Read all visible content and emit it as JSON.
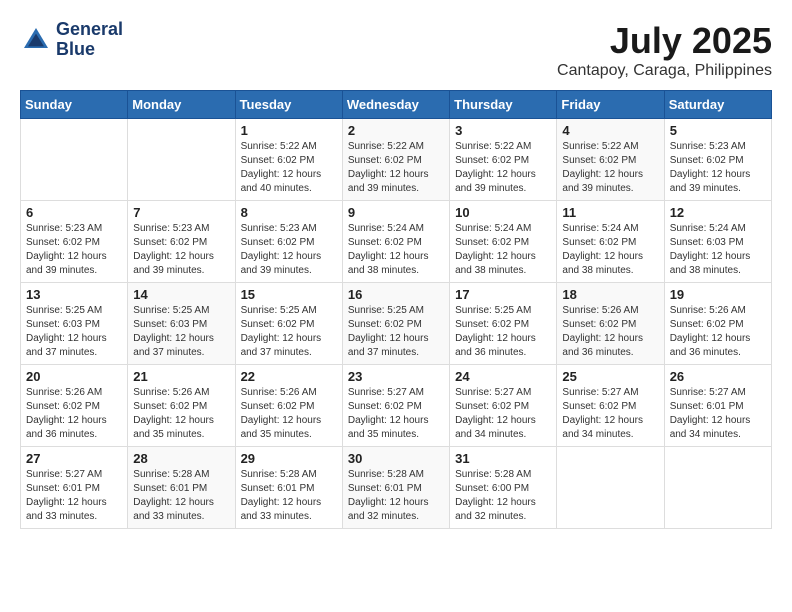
{
  "app": {
    "name_line1": "General",
    "name_line2": "Blue"
  },
  "calendar": {
    "title": "July 2025",
    "subtitle": "Cantapoy, Caraga, Philippines"
  },
  "headers": [
    "Sunday",
    "Monday",
    "Tuesday",
    "Wednesday",
    "Thursday",
    "Friday",
    "Saturday"
  ],
  "weeks": [
    [
      {
        "day": "",
        "sunrise": "",
        "sunset": "",
        "daylight": ""
      },
      {
        "day": "",
        "sunrise": "",
        "sunset": "",
        "daylight": ""
      },
      {
        "day": "1",
        "sunrise": "Sunrise: 5:22 AM",
        "sunset": "Sunset: 6:02 PM",
        "daylight": "Daylight: 12 hours and 40 minutes."
      },
      {
        "day": "2",
        "sunrise": "Sunrise: 5:22 AM",
        "sunset": "Sunset: 6:02 PM",
        "daylight": "Daylight: 12 hours and 39 minutes."
      },
      {
        "day": "3",
        "sunrise": "Sunrise: 5:22 AM",
        "sunset": "Sunset: 6:02 PM",
        "daylight": "Daylight: 12 hours and 39 minutes."
      },
      {
        "day": "4",
        "sunrise": "Sunrise: 5:22 AM",
        "sunset": "Sunset: 6:02 PM",
        "daylight": "Daylight: 12 hours and 39 minutes."
      },
      {
        "day": "5",
        "sunrise": "Sunrise: 5:23 AM",
        "sunset": "Sunset: 6:02 PM",
        "daylight": "Daylight: 12 hours and 39 minutes."
      }
    ],
    [
      {
        "day": "6",
        "sunrise": "Sunrise: 5:23 AM",
        "sunset": "Sunset: 6:02 PM",
        "daylight": "Daylight: 12 hours and 39 minutes."
      },
      {
        "day": "7",
        "sunrise": "Sunrise: 5:23 AM",
        "sunset": "Sunset: 6:02 PM",
        "daylight": "Daylight: 12 hours and 39 minutes."
      },
      {
        "day": "8",
        "sunrise": "Sunrise: 5:23 AM",
        "sunset": "Sunset: 6:02 PM",
        "daylight": "Daylight: 12 hours and 39 minutes."
      },
      {
        "day": "9",
        "sunrise": "Sunrise: 5:24 AM",
        "sunset": "Sunset: 6:02 PM",
        "daylight": "Daylight: 12 hours and 38 minutes."
      },
      {
        "day": "10",
        "sunrise": "Sunrise: 5:24 AM",
        "sunset": "Sunset: 6:02 PM",
        "daylight": "Daylight: 12 hours and 38 minutes."
      },
      {
        "day": "11",
        "sunrise": "Sunrise: 5:24 AM",
        "sunset": "Sunset: 6:02 PM",
        "daylight": "Daylight: 12 hours and 38 minutes."
      },
      {
        "day": "12",
        "sunrise": "Sunrise: 5:24 AM",
        "sunset": "Sunset: 6:03 PM",
        "daylight": "Daylight: 12 hours and 38 minutes."
      }
    ],
    [
      {
        "day": "13",
        "sunrise": "Sunrise: 5:25 AM",
        "sunset": "Sunset: 6:03 PM",
        "daylight": "Daylight: 12 hours and 37 minutes."
      },
      {
        "day": "14",
        "sunrise": "Sunrise: 5:25 AM",
        "sunset": "Sunset: 6:03 PM",
        "daylight": "Daylight: 12 hours and 37 minutes."
      },
      {
        "day": "15",
        "sunrise": "Sunrise: 5:25 AM",
        "sunset": "Sunset: 6:02 PM",
        "daylight": "Daylight: 12 hours and 37 minutes."
      },
      {
        "day": "16",
        "sunrise": "Sunrise: 5:25 AM",
        "sunset": "Sunset: 6:02 PM",
        "daylight": "Daylight: 12 hours and 37 minutes."
      },
      {
        "day": "17",
        "sunrise": "Sunrise: 5:25 AM",
        "sunset": "Sunset: 6:02 PM",
        "daylight": "Daylight: 12 hours and 36 minutes."
      },
      {
        "day": "18",
        "sunrise": "Sunrise: 5:26 AM",
        "sunset": "Sunset: 6:02 PM",
        "daylight": "Daylight: 12 hours and 36 minutes."
      },
      {
        "day": "19",
        "sunrise": "Sunrise: 5:26 AM",
        "sunset": "Sunset: 6:02 PM",
        "daylight": "Daylight: 12 hours and 36 minutes."
      }
    ],
    [
      {
        "day": "20",
        "sunrise": "Sunrise: 5:26 AM",
        "sunset": "Sunset: 6:02 PM",
        "daylight": "Daylight: 12 hours and 36 minutes."
      },
      {
        "day": "21",
        "sunrise": "Sunrise: 5:26 AM",
        "sunset": "Sunset: 6:02 PM",
        "daylight": "Daylight: 12 hours and 35 minutes."
      },
      {
        "day": "22",
        "sunrise": "Sunrise: 5:26 AM",
        "sunset": "Sunset: 6:02 PM",
        "daylight": "Daylight: 12 hours and 35 minutes."
      },
      {
        "day": "23",
        "sunrise": "Sunrise: 5:27 AM",
        "sunset": "Sunset: 6:02 PM",
        "daylight": "Daylight: 12 hours and 35 minutes."
      },
      {
        "day": "24",
        "sunrise": "Sunrise: 5:27 AM",
        "sunset": "Sunset: 6:02 PM",
        "daylight": "Daylight: 12 hours and 34 minutes."
      },
      {
        "day": "25",
        "sunrise": "Sunrise: 5:27 AM",
        "sunset": "Sunset: 6:02 PM",
        "daylight": "Daylight: 12 hours and 34 minutes."
      },
      {
        "day": "26",
        "sunrise": "Sunrise: 5:27 AM",
        "sunset": "Sunset: 6:01 PM",
        "daylight": "Daylight: 12 hours and 34 minutes."
      }
    ],
    [
      {
        "day": "27",
        "sunrise": "Sunrise: 5:27 AM",
        "sunset": "Sunset: 6:01 PM",
        "daylight": "Daylight: 12 hours and 33 minutes."
      },
      {
        "day": "28",
        "sunrise": "Sunrise: 5:28 AM",
        "sunset": "Sunset: 6:01 PM",
        "daylight": "Daylight: 12 hours and 33 minutes."
      },
      {
        "day": "29",
        "sunrise": "Sunrise: 5:28 AM",
        "sunset": "Sunset: 6:01 PM",
        "daylight": "Daylight: 12 hours and 33 minutes."
      },
      {
        "day": "30",
        "sunrise": "Sunrise: 5:28 AM",
        "sunset": "Sunset: 6:01 PM",
        "daylight": "Daylight: 12 hours and 32 minutes."
      },
      {
        "day": "31",
        "sunrise": "Sunrise: 5:28 AM",
        "sunset": "Sunset: 6:00 PM",
        "daylight": "Daylight: 12 hours and 32 minutes."
      },
      {
        "day": "",
        "sunrise": "",
        "sunset": "",
        "daylight": ""
      },
      {
        "day": "",
        "sunrise": "",
        "sunset": "",
        "daylight": ""
      }
    ]
  ]
}
